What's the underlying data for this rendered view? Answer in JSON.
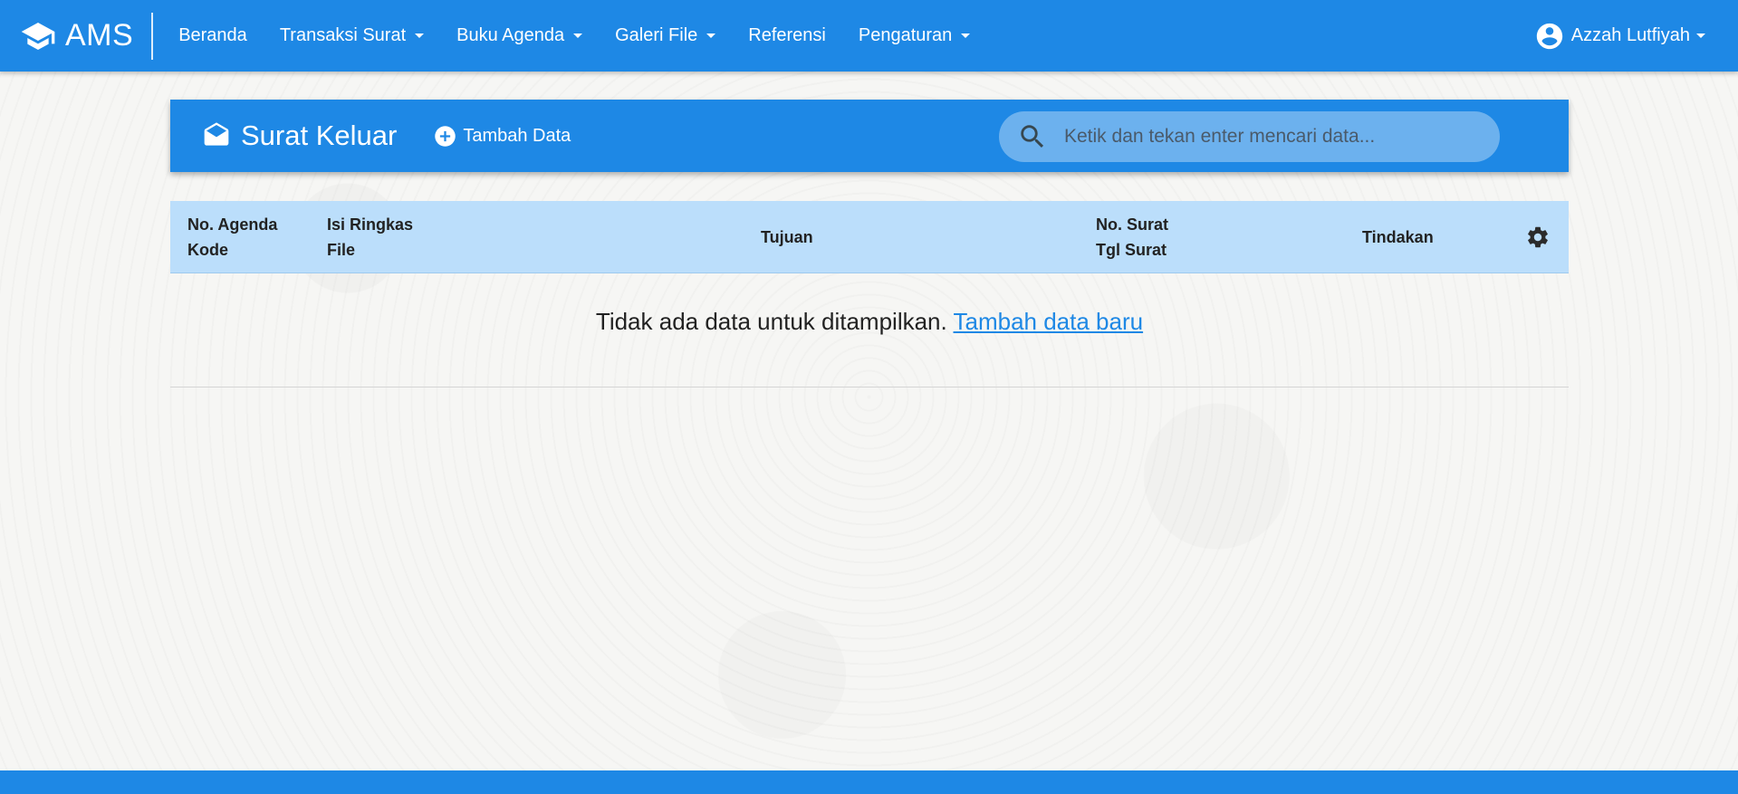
{
  "brand": {
    "name": "AMS"
  },
  "nav": {
    "items": [
      {
        "label": "Beranda",
        "dropdown": false
      },
      {
        "label": "Transaksi Surat",
        "dropdown": true
      },
      {
        "label": "Buku Agenda",
        "dropdown": true
      },
      {
        "label": "Galeri File",
        "dropdown": true
      },
      {
        "label": "Referensi",
        "dropdown": false
      },
      {
        "label": "Pengaturan",
        "dropdown": true
      }
    ],
    "user": "Azzah Lutfiyah"
  },
  "page": {
    "title": "Surat Keluar",
    "add_label": "Tambah Data",
    "search_placeholder": "Ketik dan tekan enter mencari data..."
  },
  "table": {
    "headers": {
      "agenda_line1": "No. Agenda",
      "agenda_line2": "Kode",
      "isi_line1": "Isi Ringkas",
      "isi_line2": "File",
      "tujuan": "Tujuan",
      "nosurat_line1": "No. Surat",
      "nosurat_line2": "Tgl Surat",
      "tindakan": "Tindakan"
    },
    "empty_text": "Tidak ada data untuk ditampilkan.",
    "empty_link": "Tambah data baru"
  },
  "colors": {
    "primary": "#1e88e5",
    "table_header": "#bbdefb"
  },
  "icons": [
    "graduation-cap-icon",
    "account-circle-icon",
    "drafts-icon",
    "add-circle-icon",
    "search-icon",
    "settings-icon"
  ]
}
